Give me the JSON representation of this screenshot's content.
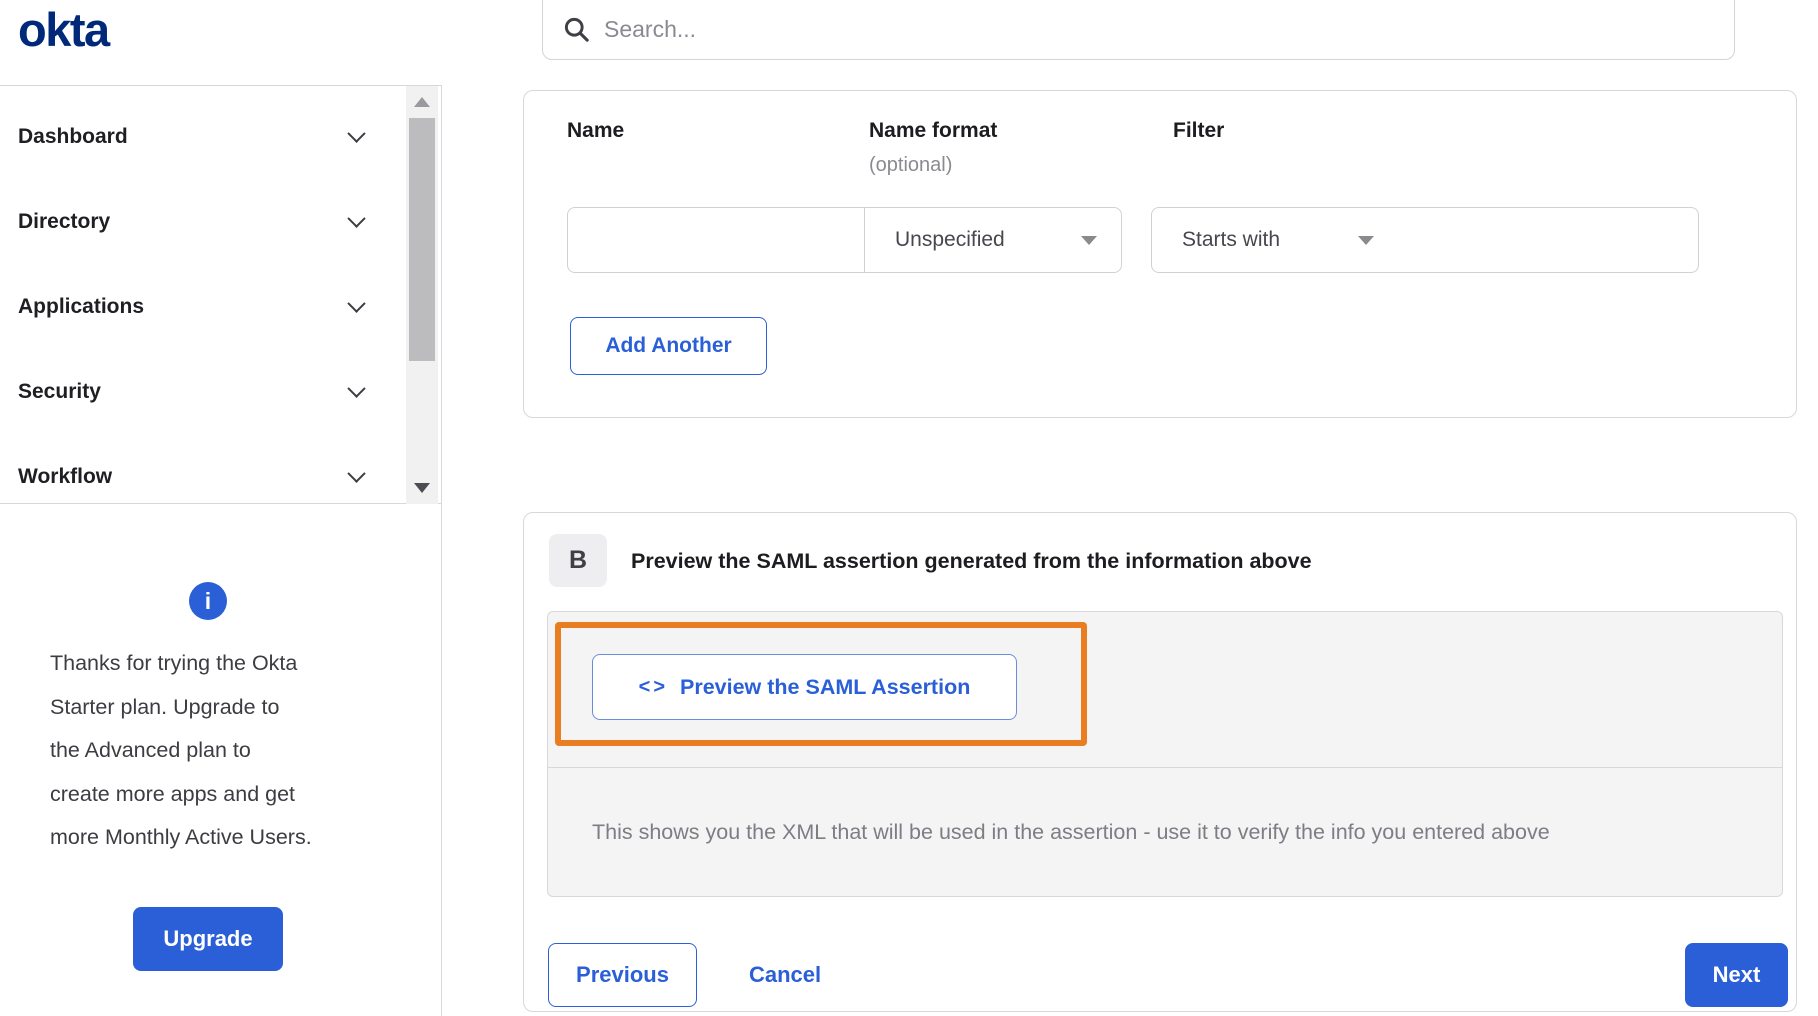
{
  "brand": {
    "logo_text": "okta"
  },
  "header": {
    "search_placeholder": "Search..."
  },
  "sidebar": {
    "menu": [
      {
        "label": "Dashboard"
      },
      {
        "label": "Directory"
      },
      {
        "label": "Applications"
      },
      {
        "label": "Security"
      },
      {
        "label": "Workflow"
      }
    ],
    "upgrade": {
      "info_icon": "i",
      "lines": [
        "Thanks for trying the Okta",
        "Starter plan. Upgrade to",
        "the Advanced plan to",
        "create more apps and get",
        "more Monthly Active Users."
      ],
      "button_label": "Upgrade"
    }
  },
  "attribute_form": {
    "columns": {
      "name_label": "Name",
      "name_format_label": "Name format",
      "name_format_hint": "(optional)",
      "filter_label": "Filter"
    },
    "row": {
      "name_value": "",
      "name_format_value": "Unspecified",
      "filter_type_value": "Starts with",
      "filter_value": ""
    },
    "add_another_label": "Add Another"
  },
  "preview_section": {
    "step_badge": "B",
    "title": "Preview the SAML assertion generated from the information above",
    "preview_button_icon": "<>",
    "preview_button_label": "Preview the SAML Assertion",
    "description": "This shows you the XML that will be used in the assertion - use it to verify the info you entered above"
  },
  "footer": {
    "previous_label": "Previous",
    "cancel_label": "Cancel",
    "next_label": "Next"
  },
  "colors": {
    "accent_blue": "#2a5fd8",
    "logo_navy": "#00297a",
    "highlight_orange": "#e87d22",
    "panel_gray": "#f4f4f5"
  }
}
